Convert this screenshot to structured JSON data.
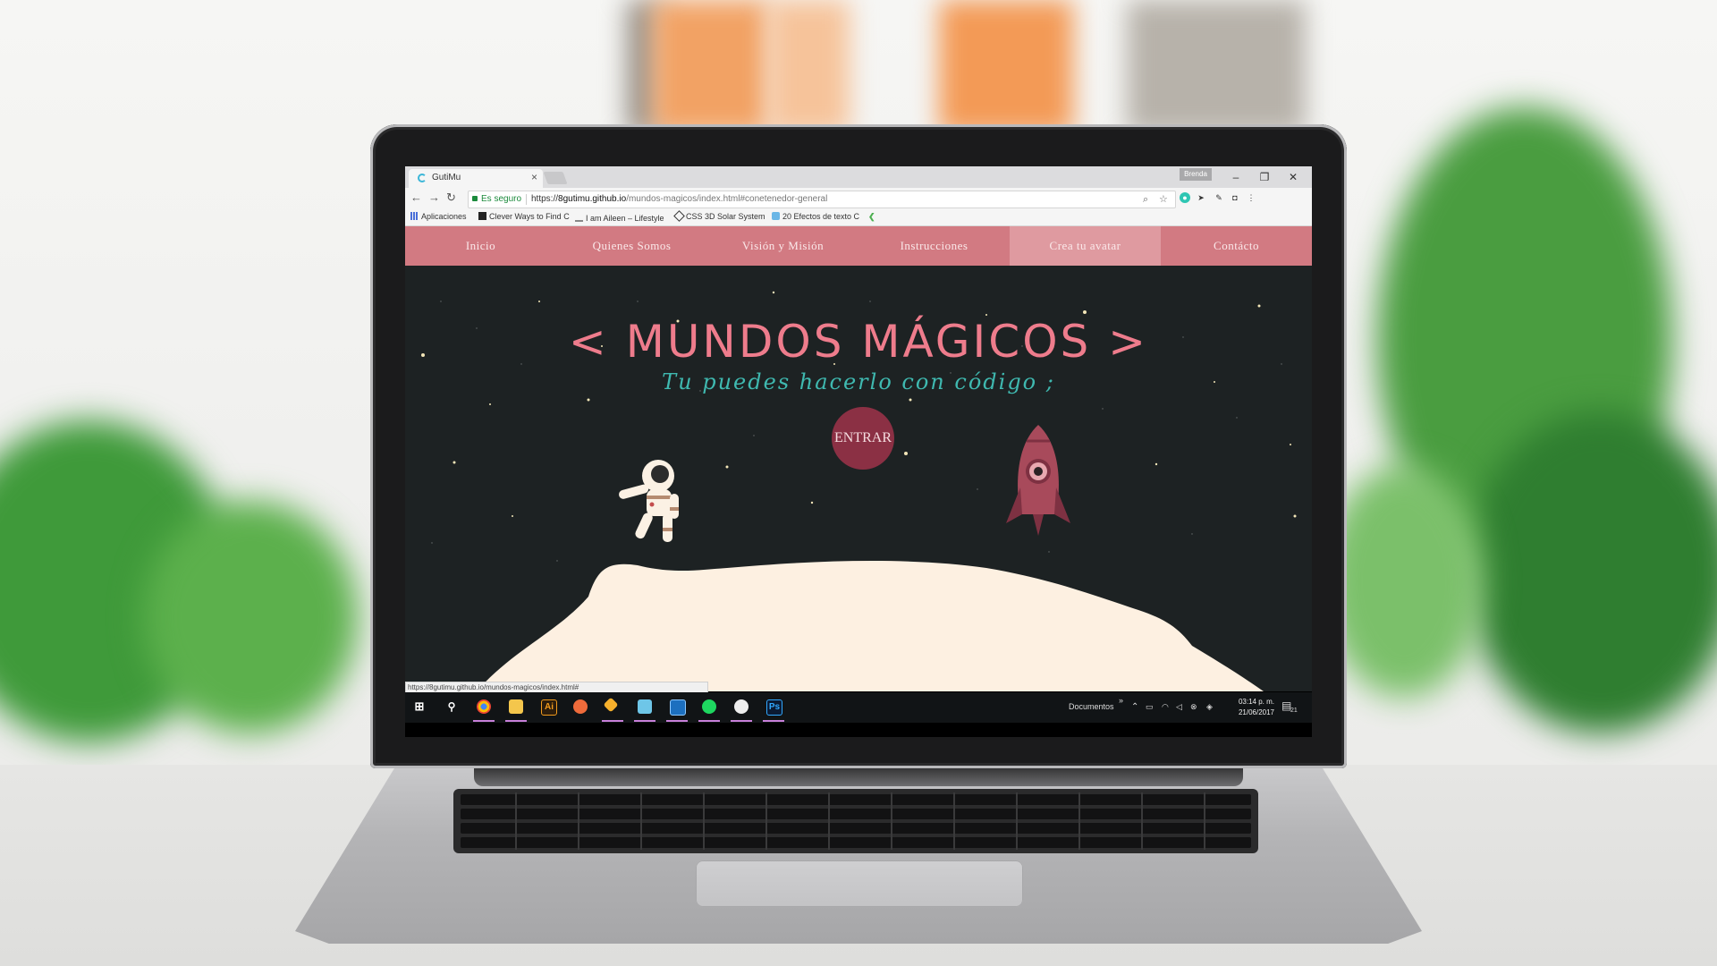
{
  "browser": {
    "tab_title": "GutiMu",
    "tab_close": "×",
    "profile_name": "Brenda",
    "window_controls": [
      "–",
      "❐",
      "✕"
    ],
    "secure_label": "Es seguro",
    "url_scheme": "https://",
    "url_host": "8gutimu.github.io",
    "url_path": "/mundos-magicos/index.html#conetenedor-general",
    "bookmarks": [
      {
        "label": "Aplicaciones",
        "icon": "apps-grid-icon"
      },
      {
        "label": "Clever Ways to Find C",
        "icon": "h-logo-icon"
      },
      {
        "label": "I am Aileen – Lifestyle",
        "icon": "aileen-icon"
      },
      {
        "label": "CSS 3D Solar System",
        "icon": "codepen-icon"
      },
      {
        "label": "20 Efectos de texto C",
        "icon": "bookmark-icon"
      }
    ]
  },
  "site": {
    "nav": [
      {
        "label": "Inicio",
        "active": false
      },
      {
        "label": "Quienes Somos",
        "active": false
      },
      {
        "label": "Visión y Misión",
        "active": false
      },
      {
        "label": "Instrucciones",
        "active": false
      },
      {
        "label": "Crea tu avatar",
        "active": true
      },
      {
        "label": "Contácto",
        "active": false
      }
    ],
    "hero_title": "< MUNDOS MÁGICOS >",
    "hero_subtitle": "Tu puedes hacerlo con código ;",
    "enter_label": "ENTRAR",
    "status_url": "https://8gutimu.github.io/mundos-magicos/index.html#"
  },
  "taskbar": {
    "folder_label": "Documentos",
    "chevron": "»",
    "time": "03:14 p. m.",
    "date": "21/06/2017",
    "notification_count": "21",
    "apps": [
      "windows-start-icon",
      "search-icon",
      "chrome-icon",
      "file-explorer-icon",
      "illustrator-icon",
      "brackets-icon",
      "sketch-icon",
      "notepad-icon",
      "code-icon",
      "spotify-icon",
      "slack-icon",
      "photoshop-icon"
    ]
  },
  "colors": {
    "nav_bg": "#d27a82",
    "hero_title": "#ee7c8c",
    "hero_subtitle": "#3fb9b0",
    "enter_button": "#8b3044",
    "space_bg": "#1d2223",
    "moon": "#fdf0e1"
  }
}
